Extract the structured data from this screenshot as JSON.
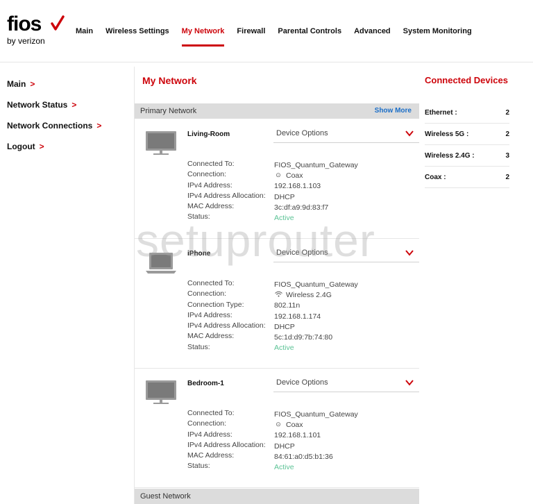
{
  "logo": {
    "brand": "fios",
    "sub": "by verizon"
  },
  "topnav": [
    {
      "label": "Main",
      "active": false
    },
    {
      "label": "Wireless Settings",
      "active": false
    },
    {
      "label": "My Network",
      "active": true
    },
    {
      "label": "Firewall",
      "active": false
    },
    {
      "label": "Parental Controls",
      "active": false
    },
    {
      "label": "Advanced",
      "active": false
    },
    {
      "label": "System Monitoring",
      "active": false
    }
  ],
  "sidebar": [
    {
      "label": "Main"
    },
    {
      "label": "Network Status"
    },
    {
      "label": "Network Connections"
    },
    {
      "label": "Logout"
    }
  ],
  "main": {
    "title": "My Network",
    "primary_section": "Primary Network",
    "show_more": "Show More",
    "guest_section": "Guest Network",
    "device_options_label": "Device Options",
    "devices": [
      {
        "name": "Living-Room",
        "icon": "monitor-icon",
        "rows": [
          {
            "label": "Connected To:",
            "value": "FIOS_Quantum_Gateway"
          },
          {
            "label": "Connection:",
            "value": "Coax",
            "icon": "coax-icon"
          },
          {
            "label": "IPv4 Address:",
            "value": "192.168.1.103"
          },
          {
            "label": "IPv4 Address Allocation:",
            "value": "DHCP"
          },
          {
            "label": "MAC Address:",
            "value": "3c:df:a9:9d:83:f7"
          },
          {
            "label": "Status:",
            "value": "Active"
          }
        ]
      },
      {
        "name": "iPhone",
        "icon": "laptop-icon",
        "rows": [
          {
            "label": "Connected To:",
            "value": "FIOS_Quantum_Gateway"
          },
          {
            "label": "Connection:",
            "value": "Wireless 2.4G",
            "icon": "wifi-icon"
          },
          {
            "label": "Connection Type:",
            "value": "802.11n"
          },
          {
            "label": "IPv4 Address:",
            "value": "192.168.1.174"
          },
          {
            "label": "IPv4 Address Allocation:",
            "value": "DHCP"
          },
          {
            "label": "MAC Address:",
            "value": "5c:1d:d9:7b:74:80"
          },
          {
            "label": "Status:",
            "value": "Active"
          }
        ]
      },
      {
        "name": "Bedroom-1",
        "icon": "monitor-icon",
        "rows": [
          {
            "label": "Connected To:",
            "value": "FIOS_Quantum_Gateway"
          },
          {
            "label": "Connection:",
            "value": "Coax",
            "icon": "coax-icon"
          },
          {
            "label": "IPv4 Address:",
            "value": "192.168.1.101"
          },
          {
            "label": "IPv4 Address Allocation:",
            "value": "DHCP"
          },
          {
            "label": "MAC Address:",
            "value": "84:61:a0:d5:b1:36"
          },
          {
            "label": "Status:",
            "value": "Active"
          }
        ]
      }
    ]
  },
  "connected_devices": {
    "title": "Connected Devices",
    "stats": [
      {
        "label": "Ethernet :",
        "value": "2"
      },
      {
        "label": "Wireless 5G :",
        "value": "2"
      },
      {
        "label": "Wireless 2.4G :",
        "value": "3"
      },
      {
        "label": "Coax :",
        "value": "2"
      }
    ]
  },
  "watermark": "setuprouter",
  "colors": {
    "accent": "#cd040b",
    "link": "#1a6ec8",
    "active_status": "#5cc396"
  }
}
